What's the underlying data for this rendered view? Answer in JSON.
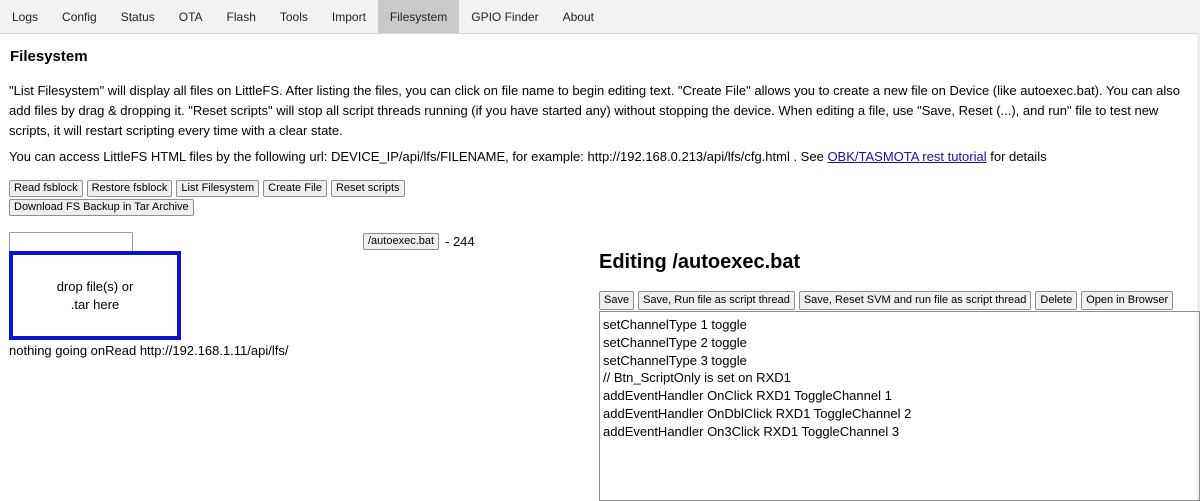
{
  "tabs": [
    {
      "label": "Logs",
      "active": false
    },
    {
      "label": "Config",
      "active": false
    },
    {
      "label": "Status",
      "active": false
    },
    {
      "label": "OTA",
      "active": false
    },
    {
      "label": "Flash",
      "active": false
    },
    {
      "label": "Tools",
      "active": false
    },
    {
      "label": "Import",
      "active": false
    },
    {
      "label": "Filesystem",
      "active": true
    },
    {
      "label": "GPIO Finder",
      "active": false
    },
    {
      "label": "About",
      "active": false
    }
  ],
  "page": {
    "title": "Filesystem",
    "description": "\"List Filesystem\" will display all files on LittleFS. After listing the files, you can click on file name to begin editing text. \"Create File\" allows you to create a new file on Device (like autoexec.bat). You can also add files by drag & dropping it. \"Reset scripts\" will stop all script threads running (if you have started any) without stopping the device. When editing a file, use \"Save, Reset (...), and run\" file to test new scripts, it will restart scripting every time with a clear state.",
    "access_prefix": "You can access LittleFS HTML files by the following url: DEVICE_IP/api/lfs/FILENAME, for example: http://192.168.0.213/api/lfs/cfg.html . See ",
    "access_link": "OBK/TASMOTA rest tutorial",
    "access_suffix": " for details"
  },
  "actions": {
    "read_fsblock": "Read fsblock",
    "restore_fsblock": "Restore fsblock",
    "list_filesystem": "List Filesystem",
    "create_file": "Create File",
    "reset_scripts": "Reset scripts",
    "download_backup": "Download FS Backup in Tar Archive"
  },
  "upload": {
    "filename_value": "",
    "dropzone_line1": "drop file(s) or",
    "dropzone_line2": ".tar here",
    "status": "nothing going onRead http://192.168.1.11/api/lfs/"
  },
  "files": [
    {
      "name": "/autoexec.bat",
      "size": "- 244"
    }
  ],
  "editor": {
    "heading": "Editing /autoexec.bat",
    "buttons": {
      "save": "Save",
      "save_run": "Save, Run file as script thread",
      "save_reset_run": "Save, Reset SVM and run file as script thread",
      "delete": "Delete",
      "open_browser": "Open in Browser"
    },
    "lines": [
      "setChannelType 1 toggle",
      "setChannelType 2 toggle",
      "setChannelType 3 toggle",
      "// Btn_ScriptOnly is set on RXD1",
      "addEventHandler OnClick RXD1 ToggleChannel 1",
      "addEventHandler OnDblClick RXD1 ToggleChannel 2",
      "addEventHandler On3Click RXD1 ToggleChannel 3"
    ]
  }
}
